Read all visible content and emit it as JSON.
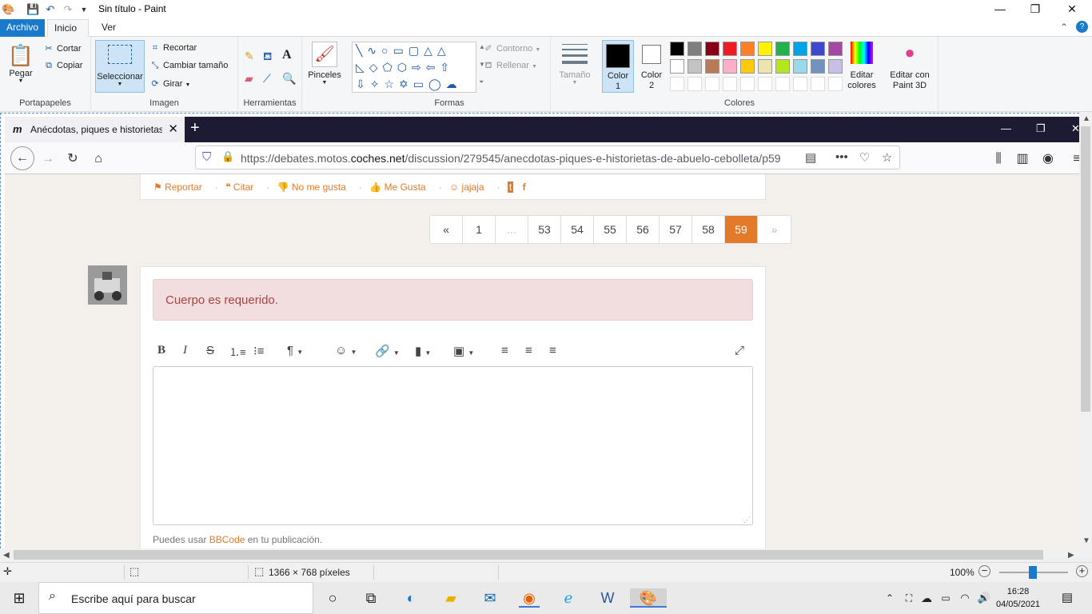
{
  "window": {
    "title": "Sin título - Paint",
    "controls": {
      "minimize": "—",
      "maximize": "❐",
      "close": "✕"
    }
  },
  "ribbon_tabs": [
    "Archivo",
    "Inicio",
    "Ver"
  ],
  "ribbon": {
    "clipboard": {
      "label": "Portapapeles",
      "paste": "Pegar",
      "cut": "Cortar",
      "copy": "Copiar"
    },
    "image": {
      "label": "Imagen",
      "select": "Seleccionar",
      "crop": "Recortar",
      "resize": "Cambiar tamaño",
      "rotate": "Girar"
    },
    "tools": {
      "label": "Herramientas"
    },
    "brushes": {
      "label": "Pinceles"
    },
    "shapes": {
      "label": "Formas",
      "outline": "Contorno",
      "fill": "Rellenar"
    },
    "size": {
      "label": "Tamaño"
    },
    "colors": {
      "label": "Colores",
      "color1": "Color\n1",
      "color2": "Color\n2",
      "edit": "Editar\ncolores",
      "paint3d": "Editar con\nPaint 3D",
      "palette_row1": [
        "#000000",
        "#7f7f7f",
        "#880015",
        "#ed1c24",
        "#ff7f27",
        "#fff200",
        "#22b14c",
        "#00a2e8",
        "#3f48cc",
        "#a349a4"
      ],
      "palette_row2": [
        "#ffffff",
        "#c3c3c3",
        "#b97a57",
        "#ffaec9",
        "#ffc90e",
        "#efe4b0",
        "#b5e61d",
        "#99d9ea",
        "#7092be",
        "#c8bfe7"
      ]
    }
  },
  "browser": {
    "tab_title": "Anécdotas, piques e historietas",
    "url_prefix": "https://debates.motos.",
    "url_domain": "coches.net",
    "url_path": "/discussion/279545/anecdotas-piques-e-historietas-de-abuelo-cebolleta/p59"
  },
  "post_actions": [
    "Reportar",
    "Citar",
    "No me gusta",
    "Me Gusta",
    "jajaja"
  ],
  "pagination": [
    "«",
    "1",
    "...",
    "53",
    "54",
    "55",
    "56",
    "57",
    "58",
    "59",
    "»"
  ],
  "current_page": "59",
  "reply": {
    "alert": "Cuerpo es requerido.",
    "hint_before": "Puedes usar ",
    "hint_link": "BBCode",
    "hint_after": " en tu publicación."
  },
  "statusbar": {
    "dimensions": "1366 × 768 píxeles",
    "zoom": "100%"
  },
  "taskbar": {
    "search_placeholder": "Escribe aquí para buscar",
    "time": "16:28",
    "date": "04/05/2021"
  }
}
